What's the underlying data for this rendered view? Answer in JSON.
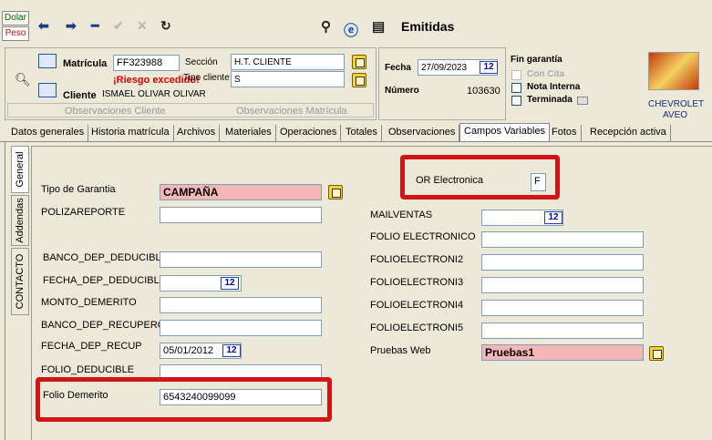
{
  "toolbar": {
    "dolar_label": "Dolar",
    "peso_label": "Peso",
    "window_title": "Emitidas"
  },
  "header": {
    "matricula_label": "Matrícula",
    "matricula_value": "FF323988",
    "seccion_label": "Sección",
    "seccion_value": "H.T. CLIENTE",
    "tipo_cliente_label": "Tipo cliente",
    "tipo_cliente_value": "S",
    "riesgo_text": "¡Riesgo excedido!",
    "cliente_label": "Cliente",
    "cliente_value": "ISMAEL OLIVAR OLIVAR",
    "obs_cliente_label": "Observaciones Cliente",
    "obs_matricula_label": "Observaciones Matrícula",
    "fecha_label": "Fecha",
    "fecha_value": "27/09/2023",
    "numero_label": "Número",
    "numero_value": "103630",
    "fin_garantia_label": "Fin garantía",
    "con_cita_label": "Con Cita",
    "nota_interna_label": "Nota Interna",
    "terminada_label": "Terminada",
    "brand_line1": "CHEVROLET",
    "brand_line2": "AVEO"
  },
  "tabs": [
    {
      "label": "Datos generales"
    },
    {
      "label": "Historia matrícula"
    },
    {
      "label": "Archivos"
    },
    {
      "label": "Materiales"
    },
    {
      "label": "Operaciones"
    },
    {
      "label": "Totales"
    },
    {
      "label": "Observaciones"
    },
    {
      "label": "Campos Variables"
    },
    {
      "label": "Fotos"
    },
    {
      "label": "Recepción activa"
    }
  ],
  "vtabs": [
    {
      "label": "General"
    },
    {
      "label": "Addendas"
    },
    {
      "label": "CONTACTO"
    }
  ],
  "left_fields": {
    "tipo_garantia_label": "Tipo de Garantia",
    "tipo_garantia_value": "CAMPAÑA",
    "polizareporte_label": "POLIZAREPORTE",
    "banco_dep_deducible_label": "BANCO_DEP_DEDUCIBLI",
    "fecha_dep_deducible_label": "FECHA_DEP_DEDUCIBLE",
    "monto_demerito_label": "MONTO_DEMERITO",
    "banco_dep_recupero_label": "BANCO_DEP_RECUPERO",
    "fecha_dep_recup_label": "FECHA_DEP_RECUP",
    "fecha_dep_recup_value": "05/01/2012",
    "folio_deducible_label": "FOLIO_DEDUCIBLE",
    "folio_demerito_label": "Folio Demerito",
    "folio_demerito_value": "6543240099099"
  },
  "right_fields": {
    "or_electronica_label": "OR Electronica",
    "or_electronica_value": "F",
    "mailventas_label": "MAILVENTAS",
    "folio_electronico_label": "FOLIO ELECTRONICO",
    "folioelectroni2_label": "FOLIOELECTRONI2",
    "folioelectroni3_label": "FOLIOELECTRONI3",
    "folioelectroni4_label": "FOLIOELECTRONI4",
    "folioelectroni5_label": "FOLIOELECTRONI5",
    "pruebas_web_label": "Pruebas Web",
    "pruebas_web_value": "Pruebas1"
  },
  "calendar_glyph": "12"
}
